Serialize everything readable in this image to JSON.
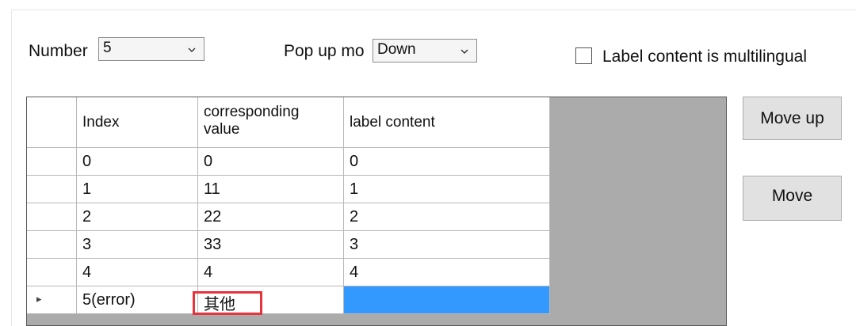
{
  "controls": {
    "number_label": "Number",
    "number_value": "5",
    "popup_label": "Pop up mo",
    "popup_value": "Down",
    "checkbox_label": "Label content is multilingual",
    "checkbox_checked": false
  },
  "grid": {
    "columns": [
      "Index",
      "corresponding\nvalue",
      "label content"
    ],
    "rows": [
      [
        "0",
        "0",
        "0"
      ],
      [
        "1",
        "11",
        "1"
      ],
      [
        "2",
        "22",
        "2"
      ],
      [
        "3",
        "33",
        "3"
      ],
      [
        "4",
        "4",
        "4"
      ],
      [
        "5(error)",
        "其他",
        ""
      ]
    ],
    "current_row_indicator": "▸"
  },
  "buttons": {
    "move_up": "Move up",
    "move": "Move"
  },
  "colors": {
    "selection": "#3399ff",
    "error_highlight": "#e8323c",
    "grid_background": "#ababab"
  }
}
